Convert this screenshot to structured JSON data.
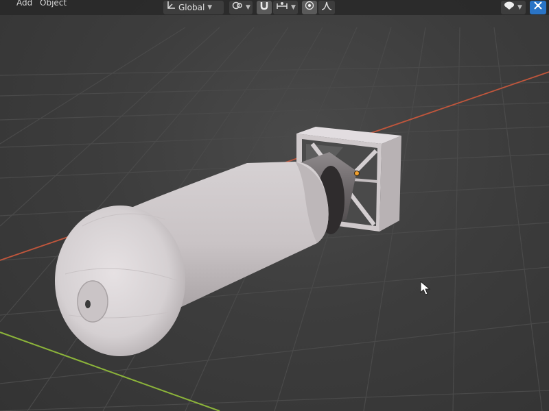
{
  "header": {
    "menu": [
      {
        "label": "Add"
      },
      {
        "label": "Object"
      }
    ],
    "transform_orientation": {
      "value": "Global",
      "icon": "orientation-icon"
    },
    "pivot": {
      "icon": "pivot-icon"
    },
    "snap": {
      "icon": "snap-magnet-icon"
    },
    "snap_target": {
      "icon": "snap-increment-icon"
    },
    "proportional_editing": {
      "icon": "proportional-editing-icon"
    },
    "falloff": {
      "icon": "falloff-curve-icon"
    },
    "viewport_shading": {
      "icon": "viewport-shading-icon"
    },
    "gizmo": {
      "icon": "navigation-gizmo-icon"
    }
  },
  "colors": {
    "grid_line": "#4a4a4a",
    "x_axis": "#c0563c",
    "y_axis": "#8cb43a",
    "object": "#d9d4d6",
    "origin_point": "#f0a030",
    "accent_blue": "#2a74c6"
  }
}
